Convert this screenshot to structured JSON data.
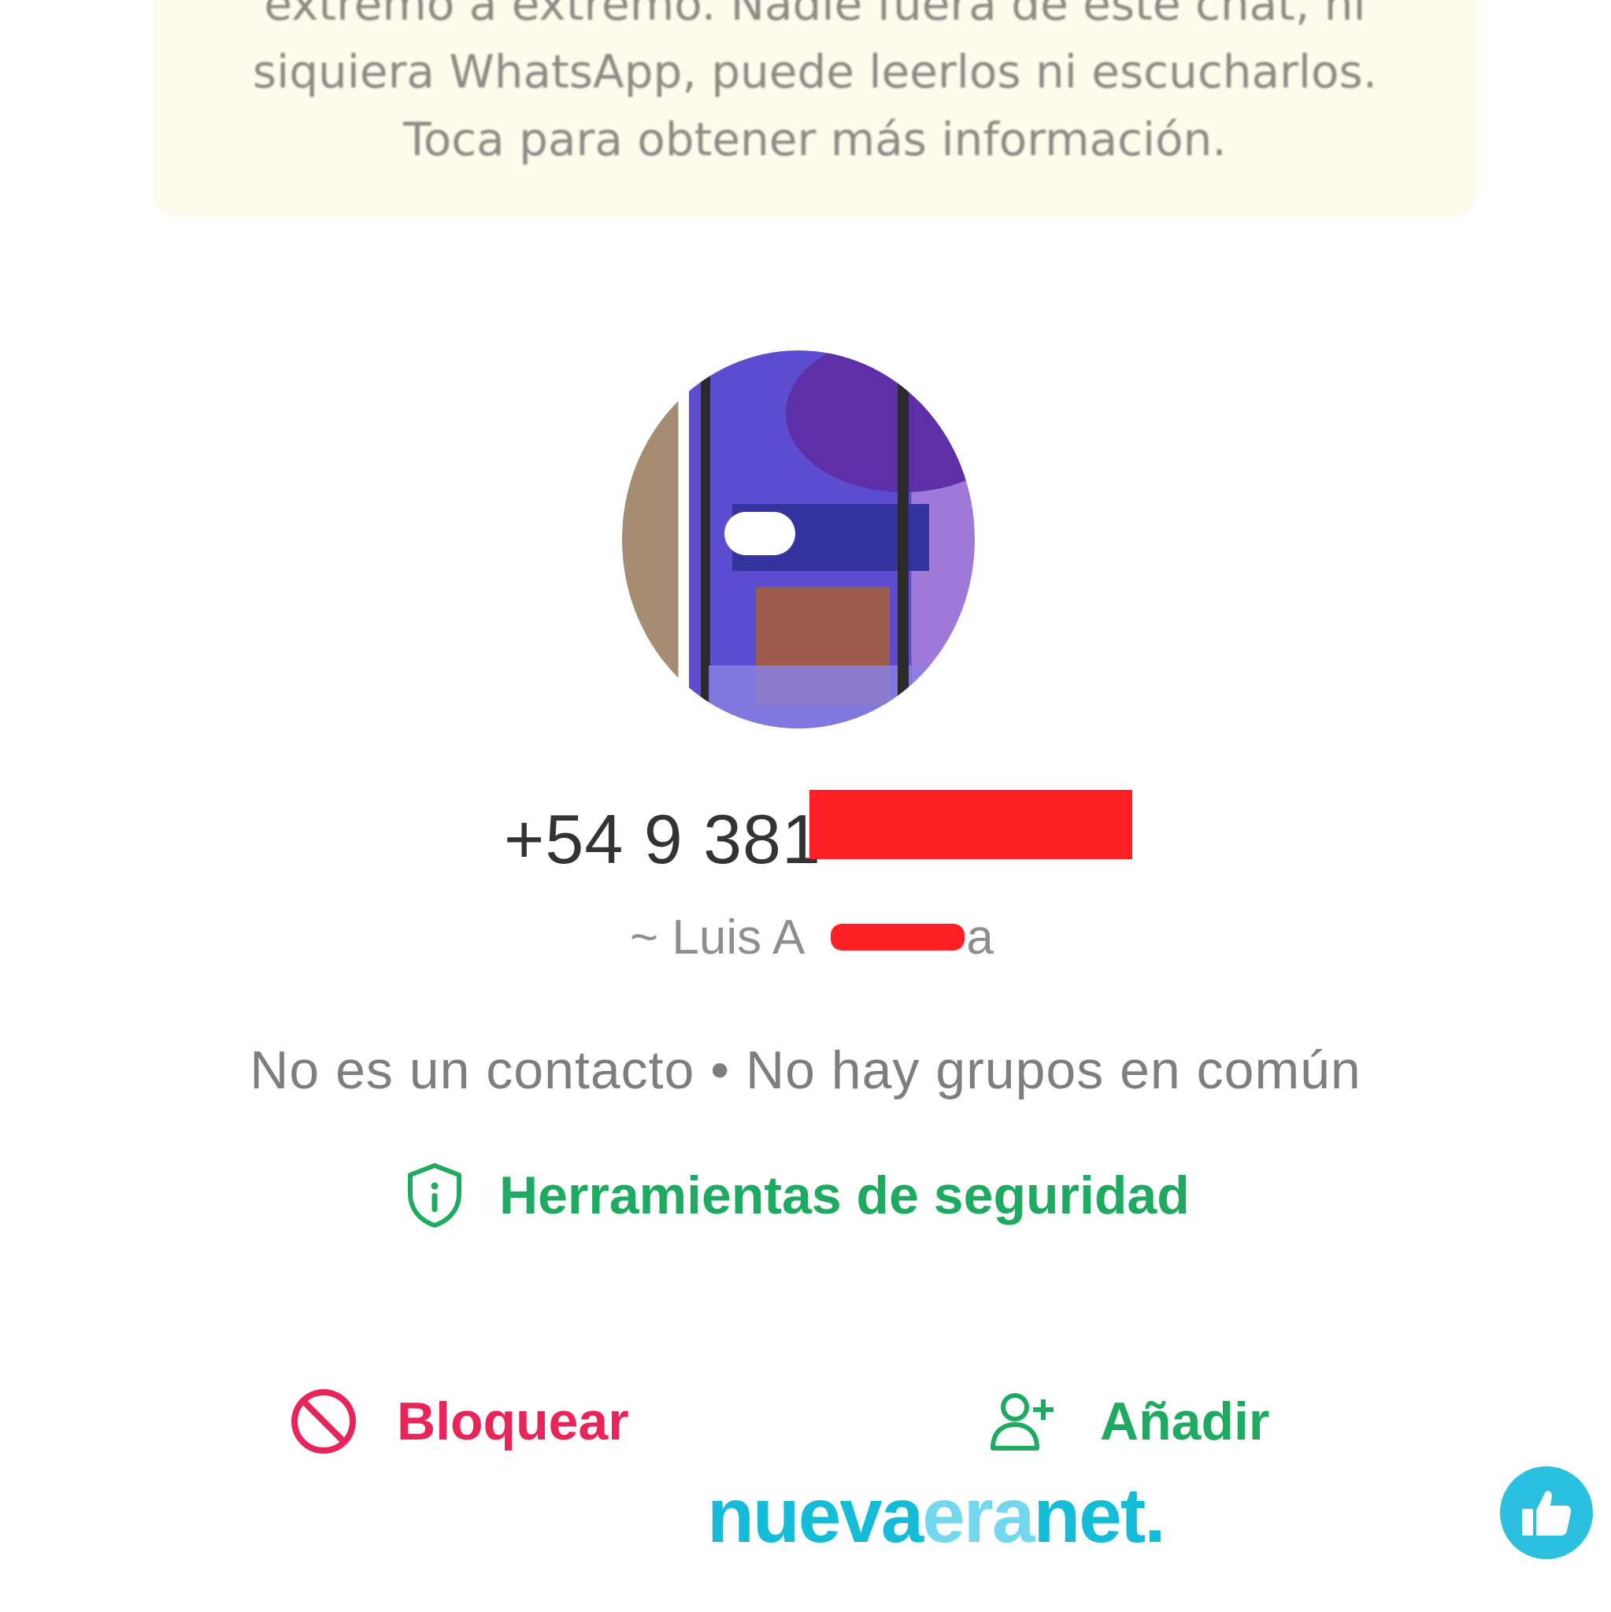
{
  "encryption_notice": {
    "line1": "extremo a extremo. Nadie fuera de este chat, ni",
    "line2": "siquiera WhatsApp, puede leerlos ni escucharlos.",
    "line3": "Toca para obtener más información."
  },
  "profile": {
    "phone_visible": "+54 9 381",
    "alias_prefix": "~ Luis A",
    "alias_suffix": "a",
    "meta": "No es un contacto • No hay grupos en común"
  },
  "safety_tools": {
    "label": "Herramientas de seguridad",
    "icon": "shield-info-icon"
  },
  "actions": {
    "block_label": "Bloquear",
    "block_icon": "block-icon",
    "add_label": "Añadir",
    "add_icon": "add-person-icon"
  },
  "watermark": {
    "part1": "nueva",
    "part2": "era",
    "part3": "net."
  },
  "like_icon": "thumbs-up-icon",
  "colors": {
    "green": "#1faa61",
    "red": "#e8245a",
    "redaction": "#ff1f24",
    "watermark_dark": "#14bcd8",
    "watermark_light": "#72d7ef"
  }
}
